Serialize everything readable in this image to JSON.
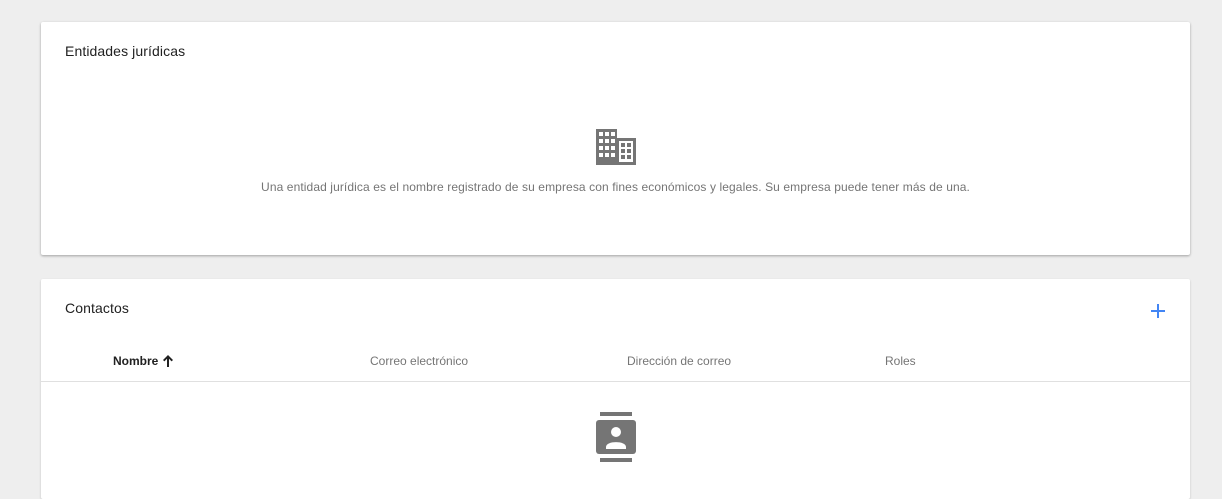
{
  "legal_entities": {
    "title": "Entidades jurídicas",
    "empty_icon": "building-icon",
    "empty_message": "Una entidad jurídica es el nombre registrado de su empresa con fines económicos y legales. Su empresa puede tener más de una."
  },
  "contacts": {
    "title": "Contactos",
    "add_icon": "add-icon",
    "columns": [
      {
        "label": "Nombre",
        "sorted": "ascending"
      },
      {
        "label": "Correo electrónico"
      },
      {
        "label": "Dirección de correo"
      },
      {
        "label": "Roles"
      }
    ],
    "sort_icon": "arrow-up-icon",
    "empty_icon": "contact-card-icon"
  },
  "colors": {
    "background": "#eeeeee",
    "card": "#ffffff",
    "accent": "#4285f4",
    "icon_gray": "#757575",
    "text_secondary": "#757575"
  }
}
